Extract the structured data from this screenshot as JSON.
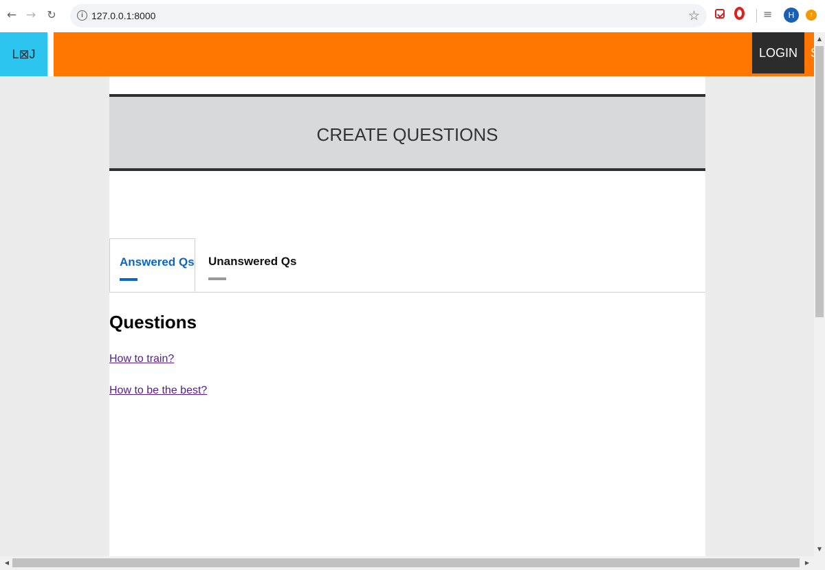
{
  "browser": {
    "url": "127.0.0.1:8000",
    "icons": {
      "back": "arrow-left-icon",
      "forward": "arrow-right-icon",
      "reload": "reload-icon",
      "info": "info-icon",
      "bookmark": "star-icon",
      "pocket": "pocket-icon",
      "opera": "opera-icon",
      "media": "media-playlist-icon",
      "update": "update-icon"
    },
    "avatar_letter": "H"
  },
  "header": {
    "logo_text": "L⊠J",
    "login_label": "LOGIN",
    "signup_label": "SIGN UP",
    "colors": {
      "logo": "#2bc5ef",
      "bar": "#ff7700",
      "login_bg": "#2c2c2c"
    }
  },
  "banner": {
    "title": "CREATE QUESTIONS"
  },
  "tabs": [
    {
      "label": "Answered Qs",
      "active": true
    },
    {
      "label": "Unanswered Qs",
      "active": false
    }
  ],
  "questions": {
    "heading": "Questions",
    "items": [
      {
        "text": "How to train?"
      },
      {
        "text": "How to be the best?"
      }
    ]
  }
}
